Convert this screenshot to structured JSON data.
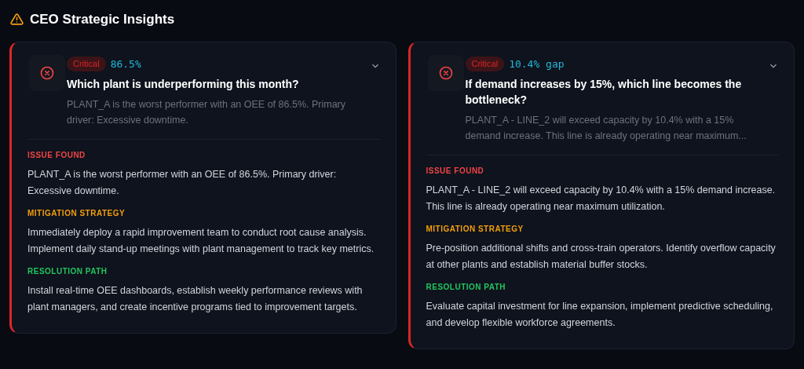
{
  "header": {
    "title": "CEO Strategic Insights"
  },
  "insights": [
    {
      "severity": "Critical",
      "metric": "86.5%",
      "question": "Which plant is underperforming this month?",
      "summary": "PLANT_A is the worst performer with an OEE of 86.5%. Primary driver: Excessive downtime.",
      "expanded": true,
      "sections": [
        {
          "kind": "issue",
          "label": "ISSUE FOUND",
          "text": "PLANT_A is the worst performer with an OEE of 86.5%. Primary driver: Excessive downtime."
        },
        {
          "kind": "mitigation",
          "label": "MITIGATION STRATEGY",
          "text": "Immediately deploy a rapid improvement team to conduct root cause analysis. Implement daily stand-up meetings with plant management to track key metrics."
        },
        {
          "kind": "resolution",
          "label": "RESOLUTION PATH",
          "text": "Install real-time OEE dashboards, establish weekly performance reviews with plant managers, and create incentive programs tied to improvement targets."
        }
      ]
    },
    {
      "severity": "Critical",
      "metric": "10.4% gap",
      "question": "If demand increases by 15%, which line becomes the bottleneck?",
      "summary": "PLANT_A - LINE_2 will exceed capacity by 10.4% with a 15% demand increase. This line is already operating near maximum...",
      "expanded": true,
      "sections": [
        {
          "kind": "issue",
          "label": "ISSUE FOUND",
          "text": "PLANT_A - LINE_2 will exceed capacity by 10.4% with a 15% demand increase. This line is already operating near maximum utilization."
        },
        {
          "kind": "mitigation",
          "label": "MITIGATION STRATEGY",
          "text": "Pre-position additional shifts and cross-train operators. Identify overflow capacity at other plants and establish material buffer stocks."
        },
        {
          "kind": "resolution",
          "label": "RESOLUTION PATH",
          "text": "Evaluate capital investment for line expansion, implement predictive scheduling, and develop flexible workforce agreements."
        }
      ]
    }
  ]
}
